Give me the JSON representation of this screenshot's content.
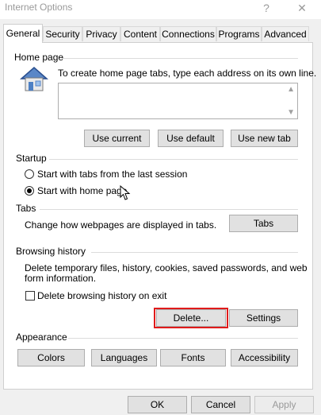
{
  "window": {
    "title": "Internet Options",
    "help_glyph": "?",
    "close_glyph": "✕"
  },
  "tabs": [
    {
      "label": "General",
      "active": true
    },
    {
      "label": "Security"
    },
    {
      "label": "Privacy"
    },
    {
      "label": "Content"
    },
    {
      "label": "Connections"
    },
    {
      "label": "Programs"
    },
    {
      "label": "Advanced"
    }
  ],
  "home_page": {
    "heading": "Home page",
    "description": "To create home page tabs, type each address on its own line.",
    "address_value": "",
    "buttons": {
      "use_current": "Use current",
      "use_default": "Use default",
      "use_new_tab": "Use new tab"
    }
  },
  "startup": {
    "heading": "Startup",
    "options": [
      {
        "label": "Start with tabs from the last session",
        "selected": false
      },
      {
        "label": "Start with home page",
        "selected": true
      }
    ]
  },
  "tabs_section": {
    "heading": "Tabs",
    "description": "Change how webpages are displayed in tabs.",
    "button": "Tabs"
  },
  "browsing_history": {
    "heading": "Browsing history",
    "description_line1": "Delete temporary files, history, cookies, saved passwords, and web",
    "description_line2": "form information.",
    "checkbox_label": "Delete browsing history on exit",
    "checkbox_checked": false,
    "delete_button": "Delete...",
    "settings_button": "Settings",
    "highlight_color": "#e01b1b"
  },
  "appearance": {
    "heading": "Appearance",
    "buttons": {
      "colors": "Colors",
      "languages": "Languages",
      "fonts": "Fonts",
      "accessibility": "Accessibility"
    }
  },
  "footer": {
    "ok": "OK",
    "cancel": "Cancel",
    "apply": "Apply",
    "apply_enabled": false
  }
}
